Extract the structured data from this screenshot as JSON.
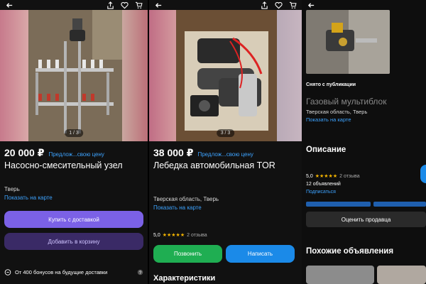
{
  "listings": [
    {
      "price": "20 000 ₽",
      "offer_link": "Предлож...свою цену",
      "title": "Насосно-смесительный узел",
      "photo_counter": "1 / 3",
      "location": "Тверь",
      "map_link": "Показать на карте",
      "buy_delivery_label": "Купить с доставкой",
      "add_cart_label": "Добавить в корзину",
      "bonus_text": "От 400 бонусов на будущие доставки"
    },
    {
      "price": "38 000 ₽",
      "offer_link": "Предлож...свою цену",
      "title": "Лебедка автомобильная TOR",
      "photo_counter": "3 / 3",
      "location": "Тверская область, Тверь",
      "map_link": "Показать на карте",
      "rating": "5,0",
      "reviews": "2 отзыва",
      "call_label": "Позвонить",
      "write_label": "Написать",
      "characteristics_heading": "Характеристики"
    },
    {
      "status": "Снято с публикации",
      "title": "Газовый мультиблок",
      "location": "Тверская область, Тверь",
      "map_link": "Показать на карте",
      "description_heading": "Описание",
      "rating": "5,0",
      "reviews": "2 отзыва",
      "ads_count": "12 объявлений",
      "subscribe_link": "Подписаться",
      "rate_seller_label": "Оценить продавца",
      "similar_heading": "Похожие объявления"
    }
  ],
  "stars": "★★★★★",
  "colors": {
    "accent_link": "#3da3ff",
    "primary_button": "#7b61e6",
    "secondary_button": "#3a2a66",
    "call_button": "#1fae52",
    "write_button": "#1b8ae8",
    "star": "#f4b400"
  }
}
